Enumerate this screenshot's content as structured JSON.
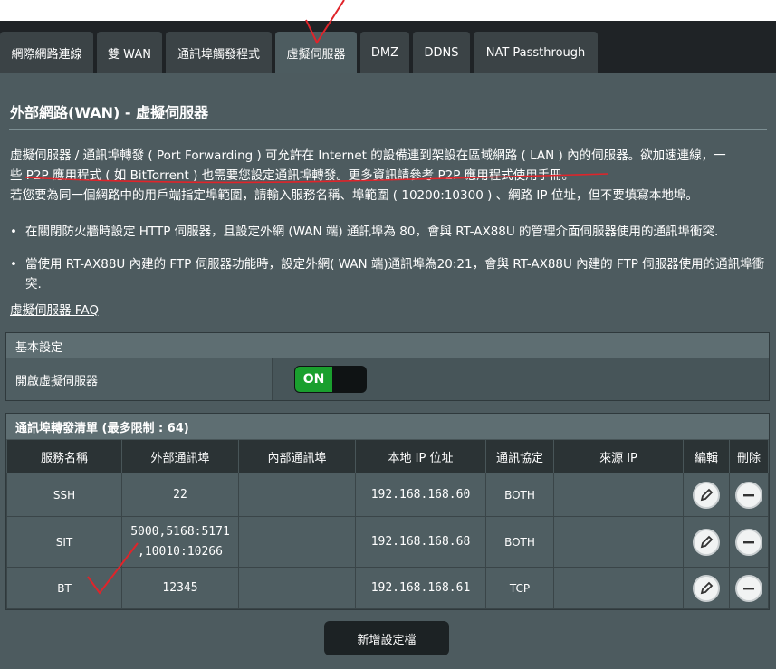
{
  "tabs": [
    {
      "label": "網際網路連線",
      "active": false
    },
    {
      "label": "雙 WAN",
      "active": false
    },
    {
      "label": "通訊埠觸發程式",
      "active": false
    },
    {
      "label": "虛擬伺服器",
      "active": true
    },
    {
      "label": "DMZ",
      "active": false
    },
    {
      "label": "DDNS",
      "active": false
    },
    {
      "label": "NAT Passthrough",
      "active": false
    }
  ],
  "page_title": "外部網路(WAN) - 虛擬伺服器",
  "description": {
    "line1": "虛擬伺服器 / 通訊埠轉發 ( Port Forwarding ) 可允許在 Internet 的設備連到架設在區域網路 ( LAN ) 內的伺服器。欲加速連線，一",
    "line2_prefix": "些 ",
    "line2_highlight": "P2P 應用程式 ( 如 BitTorrent ) 也需要您設定通訊埠轉發。更多資訊請參考 P2P 應用程式使用手冊",
    "line2_suffix": "。",
    "line3": "若您要為同一個網路中的用戶端指定埠範圍，請輸入服務名稱、埠範圍 ( 10200:10300 ) 、網路 IP 位址，但不要填寫本地埠。"
  },
  "bullets": [
    "在關閉防火牆時設定 HTTP 伺服器，且設定外網 (WAN 端) 通訊埠為 80，會與 RT-AX88U 的管理介面伺服器使用的通訊埠衝突.",
    "當使用 RT-AX88U 內建的 FTP 伺服器功能時，設定外網( WAN 端)通訊埠為20:21，會與 RT-AX88U 內建的 FTP 伺服器使用的通訊埠衝突."
  ],
  "faq_link": "虛擬伺服器  FAQ",
  "basic": {
    "header": "基本設定",
    "enable_label": "開啟虛擬伺服器",
    "toggle_state": "ON"
  },
  "forward_list": {
    "header": "通訊埠轉發清單 (最多限制 : 64)",
    "columns": [
      "服務名稱",
      "外部通訊埠",
      "內部通訊埠",
      "本地 IP 位址",
      "通訊協定",
      "來源 IP",
      "編輯",
      "刪除"
    ],
    "rows": [
      {
        "service": "SSH",
        "external": "22",
        "internal": "",
        "ip": "192.168.168.60",
        "protocol": "BOTH",
        "source": ""
      },
      {
        "service": "SIT",
        "external": "5000,5168:5171,10010:10266",
        "external_line1": "5000,5168:5171",
        "external_line2": ",10010:10266",
        "internal": "",
        "ip": "192.168.168.68",
        "protocol": "BOTH",
        "source": ""
      },
      {
        "service": "BT",
        "external": "12345",
        "internal": "",
        "ip": "192.168.168.61",
        "protocol": "TCP",
        "source": ""
      }
    ]
  },
  "add_button": "新增設定檔",
  "icons": {
    "edit": "pencil-icon",
    "delete": "minus-circle-icon"
  },
  "colors": {
    "panel": "#4d5b5f",
    "tabbar": "#1f2326",
    "toggle_on": "#1a9f2e",
    "annotation": "#e0242a"
  }
}
